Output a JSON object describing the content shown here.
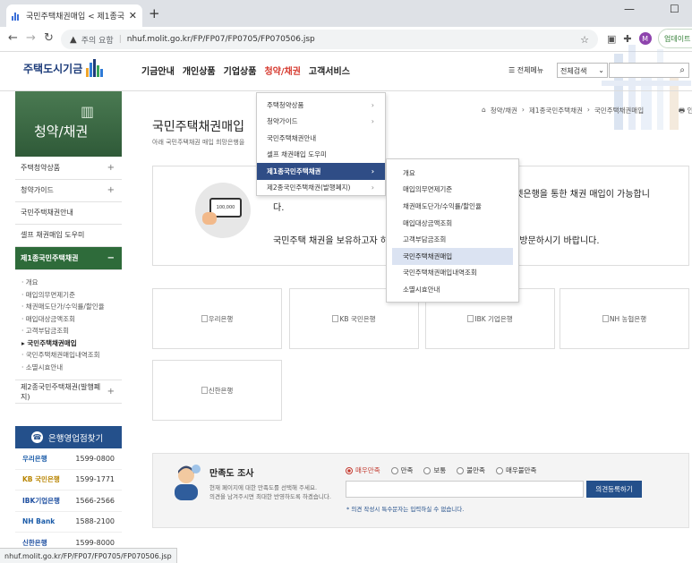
{
  "browser": {
    "tab_title": "국민주택채권매입 < 제1종국",
    "tab_close": "✕",
    "new_tab": "+",
    "window_controls": [
      "—",
      "☐"
    ],
    "nav": {
      "back": "←",
      "forward": "→",
      "reload": "↻"
    },
    "security_label": "주의 요함",
    "url": "nhuf.molit.go.kr/FP/FP07/FP0705/FP070506.jsp",
    "avatar_letter": "M",
    "update_button": "업데이트",
    "status_url": "nhuf.molit.go.kr/FP/FP07/FP0705/FP070506.jsp"
  },
  "site": {
    "logo_text": "주택도시기금",
    "gnb": [
      "기금안내",
      "개인상품",
      "기업상품",
      "청약/채권",
      "고객서비스"
    ],
    "gnb_active_index": 3,
    "all_menu": "☰ 전체메뉴",
    "search_select": "전체검색",
    "search_icon": "🔍"
  },
  "lnb": {
    "title": "청약/채권",
    "items": [
      {
        "label": "주택청약상품",
        "toggle": "+"
      },
      {
        "label": "청약가이드",
        "toggle": "+"
      },
      {
        "label": "국민주택채권안내",
        "toggle": ""
      },
      {
        "label": "셀프 채권매입 도우미",
        "toggle": ""
      },
      {
        "label": "제1종국민주택채권",
        "toggle": "−"
      }
    ],
    "subitems": [
      "개요",
      "매입의무면제기준",
      "채권매도단가/수익률/할인율",
      "매입대상금액조회",
      "고객부담금조회",
      "국민주택채권매입",
      "국민주택채권매입내역조회",
      "소멸시효안내"
    ],
    "sub_current_index": 5,
    "last_item": {
      "label": "제2종국민주택채권(발행폐지)",
      "toggle": "+"
    }
  },
  "bank_finder": {
    "title": "은행영업점찾기",
    "banks": [
      {
        "name": "우리은행",
        "phone": "1599-0800",
        "color": "#1a5ba8"
      },
      {
        "name": "KB 국민은행",
        "phone": "1599-1771",
        "color": "#f0a500"
      },
      {
        "name": "IBK기업은행",
        "phone": "1566-2566",
        "color": "#1e4fa0"
      },
      {
        "name": "NH Bank",
        "phone": "1588-2100",
        "color": "#1a5ba8"
      },
      {
        "name": "신한은행",
        "phone": "1599-8000",
        "color": "#1e4fa0"
      }
    ]
  },
  "main": {
    "page_title": "국민주택채권매입",
    "page_desc": "아래 국민주택채권 매입 희망은행을",
    "breadcrumb": [
      "⌂",
      "청약/채권",
      "›",
      "제1종국민주택채권",
      "›",
      "국민주택채권매입"
    ],
    "print": "🖶 인쇄",
    "info_card": "100,000",
    "info_text1": "다.",
    "info_text1b": "터넷은행을 통한 채권 매입이 가능합니",
    "info_text2": "국민주택 채권을 보유하고자 하",
    "info_text2b": "은 방문하시기 바랍니다.",
    "bank_cards": [
      "우리은행",
      "KB 국민은행",
      "IBK 기업은행",
      "NH 농협은행",
      "신한은행"
    ]
  },
  "survey": {
    "title": "만족도 조사",
    "desc1": "현재 페이지에 대한 만족도를 선택해 주세요.",
    "desc2": "의견을 남겨주시면 최대한 반영하도록 하겠습니다.",
    "options": [
      "매우만족",
      "만족",
      "보통",
      "불만족",
      "매우불만족"
    ],
    "selected_index": 0,
    "submit": "의견등록하기",
    "note": "* 의견 작성시 특수문자는 입력하실 수 없습니다."
  },
  "dropdown_level1": {
    "items": [
      {
        "label": "주택청약상품",
        "arrow": "›"
      },
      {
        "label": "청약가이드",
        "arrow": "›"
      },
      {
        "label": "국민주택채권안내",
        "arrow": ""
      },
      {
        "label": "셀프 채권매입 도우미",
        "arrow": ""
      },
      {
        "label": "제1종국민주택채권",
        "arrow": "›"
      },
      {
        "label": "제2종국민주택채권(발행폐지)",
        "arrow": "›"
      }
    ],
    "highlight_index": 4
  },
  "dropdown_level2": {
    "items": [
      "개요",
      "매입의무면제기준",
      "채권매도단가/수익률/할인율",
      "매입대상금액조회",
      "고객부담금조회",
      "국민주택채권매입",
      "국민주택채권매입내역조회",
      "소멸시효안내"
    ],
    "highlight_index": 5
  }
}
